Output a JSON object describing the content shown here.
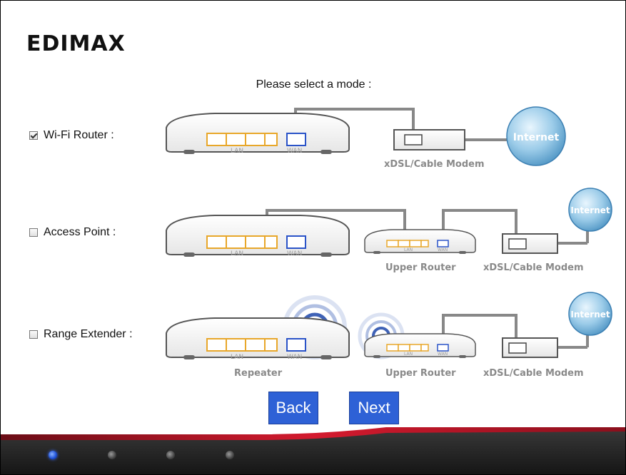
{
  "brand": {
    "logo_text": "EDIMAX"
  },
  "prompt": "Please select a mode :",
  "modes": [
    {
      "label": "Wi-Fi Router :",
      "checked": true
    },
    {
      "label": "Access Point :",
      "checked": false
    },
    {
      "label": "Range Extender :",
      "checked": false
    }
  ],
  "diagram": {
    "lan": "LAN",
    "wan": "WAN",
    "modem": "xDSL/Cable Modem",
    "internet": "Internet",
    "upper_router": "Upper Router",
    "repeater": "Repeater"
  },
  "buttons": {
    "back": "Back",
    "next": "Next"
  },
  "pagination": {
    "total": 4,
    "current": 1
  },
  "colors": {
    "button_bg": "#2e61d6",
    "lan_port": "#e8a72a",
    "wan_port": "#2a53c8",
    "footer_red": "#c8102e"
  }
}
